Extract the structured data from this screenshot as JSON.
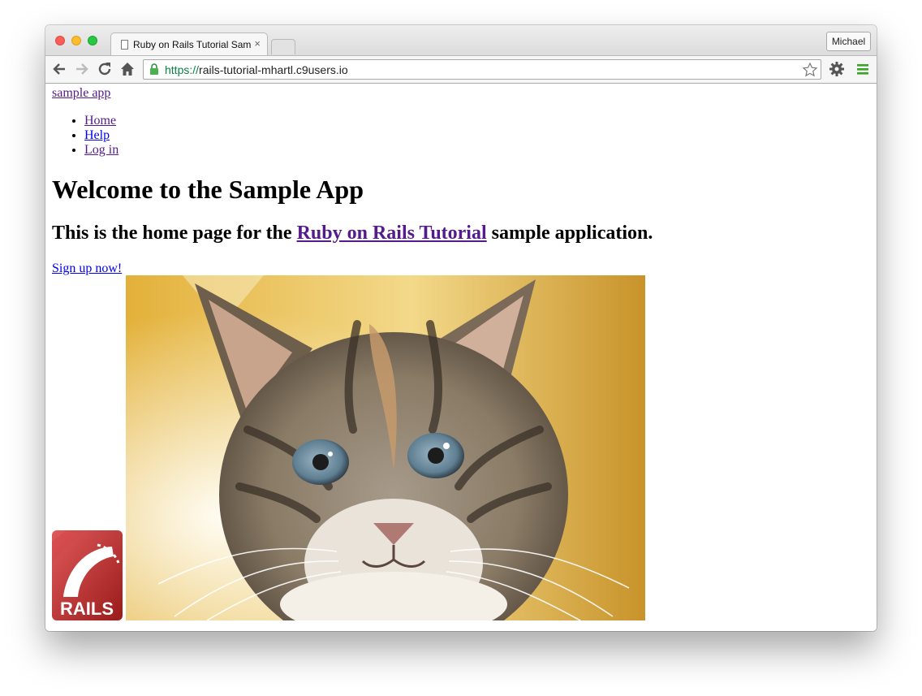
{
  "browser": {
    "tab_title": "Ruby on Rails Tutorial Sample App",
    "tab_close": "×",
    "profile_name": "Michael",
    "url_scheme": "https://",
    "url_host": "rails-tutorial-mhartl.c9users.io",
    "icons": [
      "back-arrow-icon",
      "forward-arrow-icon",
      "reload-icon",
      "home-icon",
      "lock-icon",
      "star-icon",
      "gear-icon",
      "menu-icon"
    ],
    "colors": {
      "secure": "#0b8043",
      "menu": "#3aa427"
    }
  },
  "page": {
    "logo_text": "sample app",
    "nav": [
      {
        "label": "Home"
      },
      {
        "label": "Help"
      },
      {
        "label": "Log in"
      }
    ],
    "heading": "Welcome to the Sample App",
    "subheading_prefix": "This is the home page for the ",
    "subheading_link": "Ruby on Rails Tutorial",
    "subheading_suffix": " sample application.",
    "signup_link": "Sign up now!",
    "rails_logo_text": "RAILS"
  }
}
